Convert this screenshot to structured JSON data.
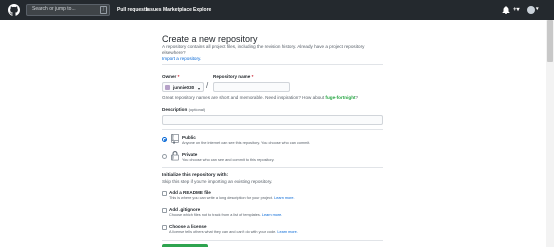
{
  "header": {
    "search_placeholder": "Search or jump to...",
    "search_shortcut": "/",
    "nav": [
      "Pull requests",
      "Issues",
      "Marketplace",
      "Explore"
    ],
    "plus_caret": "+▾"
  },
  "page": {
    "title": "Create a new repository",
    "subtitle": "A repository contains all project files, including the revision history. Already have a project repository elsewhere?",
    "import_link": "Import a repository."
  },
  "form": {
    "owner_label": "Owner",
    "owner_required": "*",
    "owner_value": "junnie030",
    "owner_caret": "▾",
    "separator": "/",
    "repo_label": "Repository name",
    "repo_required": "*",
    "repo_value": "",
    "hint_prefix": "Great repository names are short and memorable. Need inspiration? How about",
    "hint_suggestion": "fuge-fortnight",
    "hint_suffix": "?",
    "description_label": "Description",
    "description_optional": "(optional)",
    "description_value": ""
  },
  "visibility": {
    "selected": "public",
    "public_title": "Public",
    "public_desc": "Anyone on the internet can see this repository. You choose who can commit.",
    "private_title": "Private",
    "private_desc": "You choose who can see and commit to this repository."
  },
  "init": {
    "title": "Initialize this repository with:",
    "subtitle": "Skip this step if you're importing an existing repository.",
    "options": [
      {
        "title": "Add a README file",
        "desc": "This is where you can write a long description for your project.",
        "link": "Learn more."
      },
      {
        "title": "Add .gitignore",
        "desc": "Choose which files not to track from a list of templates.",
        "link": "Learn more."
      },
      {
        "title": "Choose a license",
        "desc": "A license tells others what they can and can't do with your code.",
        "link": "Learn more."
      }
    ]
  },
  "colors": {
    "header_bg": "#24292e",
    "link": "#0366d6",
    "success": "#28a745",
    "button_green": "#2ea44f"
  }
}
